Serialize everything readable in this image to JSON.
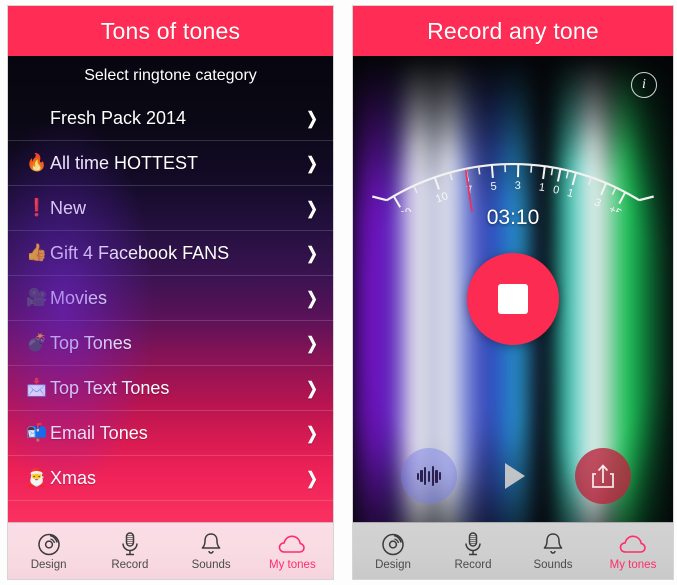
{
  "left": {
    "navbar": {
      "title": "Tons of tones"
    },
    "subtitle": "Select ringtone category",
    "rows": [
      {
        "emoji": "",
        "label": "Fresh Pack 2014",
        "chevron": "❯"
      },
      {
        "emoji": "🔥",
        "label": "All time HOTTEST",
        "chevron": "❯"
      },
      {
        "emoji": "❗",
        "label": "New",
        "chevron": "❯"
      },
      {
        "emoji": "👍",
        "label": "Gift 4 Facebook FANS",
        "chevron": "❯"
      },
      {
        "emoji": "🎥",
        "label": "Movies",
        "chevron": "❯"
      },
      {
        "emoji": "💣",
        "label": "Top Tones",
        "chevron": "❯"
      },
      {
        "emoji": "📩",
        "label": "Top Text Tones",
        "chevron": "❯"
      },
      {
        "emoji": "📬",
        "label": "Email Tones",
        "chevron": "❯"
      },
      {
        "emoji": "🎅",
        "label": "Xmas",
        "chevron": "❯"
      }
    ],
    "tabbar": {
      "tabs": [
        {
          "label": "Design",
          "icon": "vinyl-disc-icon",
          "active": false
        },
        {
          "label": "Record",
          "icon": "microphone-icon",
          "active": false
        },
        {
          "label": "Sounds",
          "icon": "bell-icon",
          "active": false
        },
        {
          "label": "My tones",
          "icon": "cloud-icon",
          "active": true
        }
      ]
    }
  },
  "right": {
    "navbar": {
      "title": "Record any tone"
    },
    "info_button": {
      "icon": "info-icon",
      "label": "i"
    },
    "vu_meter": {
      "ticks": [
        "-20",
        "10",
        "7",
        "5",
        "3",
        "1",
        "0",
        "1",
        "3",
        "+5"
      ],
      "needle_at": "7",
      "needle_color": "#e8315f"
    },
    "timer": "03:10",
    "stop_button": {
      "icon": "stop-square-icon",
      "color": "#fb2b52"
    },
    "controls": [
      {
        "name": "waveform-button",
        "icon": "waveform-icon"
      },
      {
        "name": "play-button",
        "icon": "play-triangle-icon"
      },
      {
        "name": "share-button",
        "icon": "share-upload-icon"
      }
    ],
    "tabbar": {
      "tabs": [
        {
          "label": "Design",
          "icon": "vinyl-disc-icon",
          "active": false
        },
        {
          "label": "Record",
          "icon": "microphone-icon",
          "active": false
        },
        {
          "label": "Sounds",
          "icon": "bell-icon",
          "active": false
        },
        {
          "label": "My tones",
          "icon": "cloud-icon",
          "active": true
        }
      ]
    }
  },
  "colors": {
    "accent_pink": "#ff2d55",
    "stop_red": "#fb2b52",
    "tab_active": "#ff2d6a"
  }
}
